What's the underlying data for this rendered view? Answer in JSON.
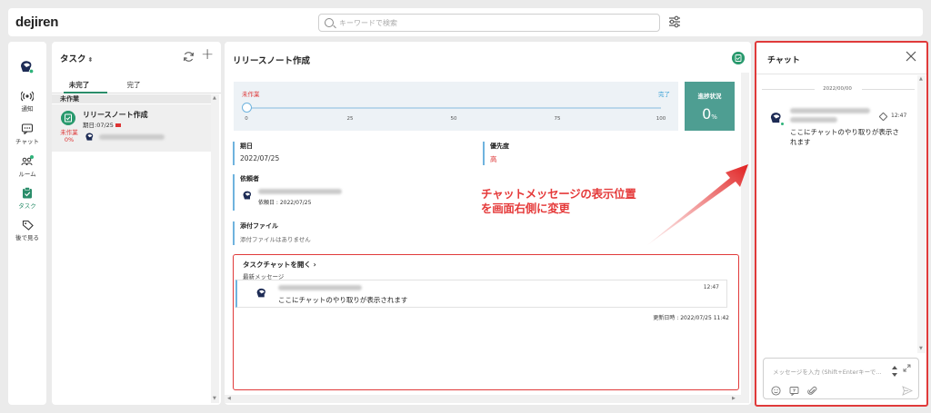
{
  "app": {
    "logo": "dejiren"
  },
  "search": {
    "placeholder": "キーワードで検索"
  },
  "nav": {
    "items": [
      {
        "label": "通知",
        "icon": "broadcast-icon"
      },
      {
        "label": "チャット",
        "icon": "chat-icon"
      },
      {
        "label": "ルーム",
        "icon": "room-icon"
      },
      {
        "label": "タスク",
        "icon": "task-icon"
      },
      {
        "label": "後で見る",
        "icon": "tag-icon"
      }
    ]
  },
  "tasklist": {
    "title": "タスク",
    "sort_glyph": "⬍",
    "tabs": [
      "未完了",
      "完了"
    ],
    "section": "未作業",
    "card": {
      "title": "リリースノート作成",
      "due": "期日:07/25",
      "status_line1": "未作業",
      "status_line2": "0%"
    }
  },
  "detail": {
    "title": "リリースノート作成",
    "progress": {
      "start_label": "未作業",
      "end_label": "完了",
      "ticks": [
        "0",
        "25",
        "50",
        "75",
        "100"
      ],
      "value": 0,
      "stat_label": "進捗状況",
      "stat_value": "0",
      "stat_unit": "%"
    },
    "due": {
      "label": "期日",
      "value": "2022/07/25"
    },
    "priority": {
      "label": "優先度",
      "value": "高"
    },
    "requester": {
      "label": "依頼者",
      "date": "依頼日 : 2022/07/25"
    },
    "attachments": {
      "label": "添付ファイル",
      "hint": "添付ファイルはありません"
    },
    "task_chat": {
      "open_label": "タスクチャットを開く",
      "latest_label": "最新メッセージ",
      "time": "12:47",
      "body": "ここにチャットのやり取りが表示されます",
      "updated": "更新日時 : 2022/07/25 11:42"
    }
  },
  "chat": {
    "title": "チャット",
    "date": "2022/00/00",
    "time": "12:47",
    "body": "ここにチャットのやり取りが表示されます",
    "placeholder": "メッセージを入力 (Shift+Enterキーで..."
  },
  "annotation": {
    "line1": "チャットメッセージの表示位置",
    "line2": "を画面右側に変更"
  },
  "colors": {
    "accent": "#2a8d6a",
    "highlight": "#e03a3a",
    "progress_stat": "#4e9e92"
  }
}
